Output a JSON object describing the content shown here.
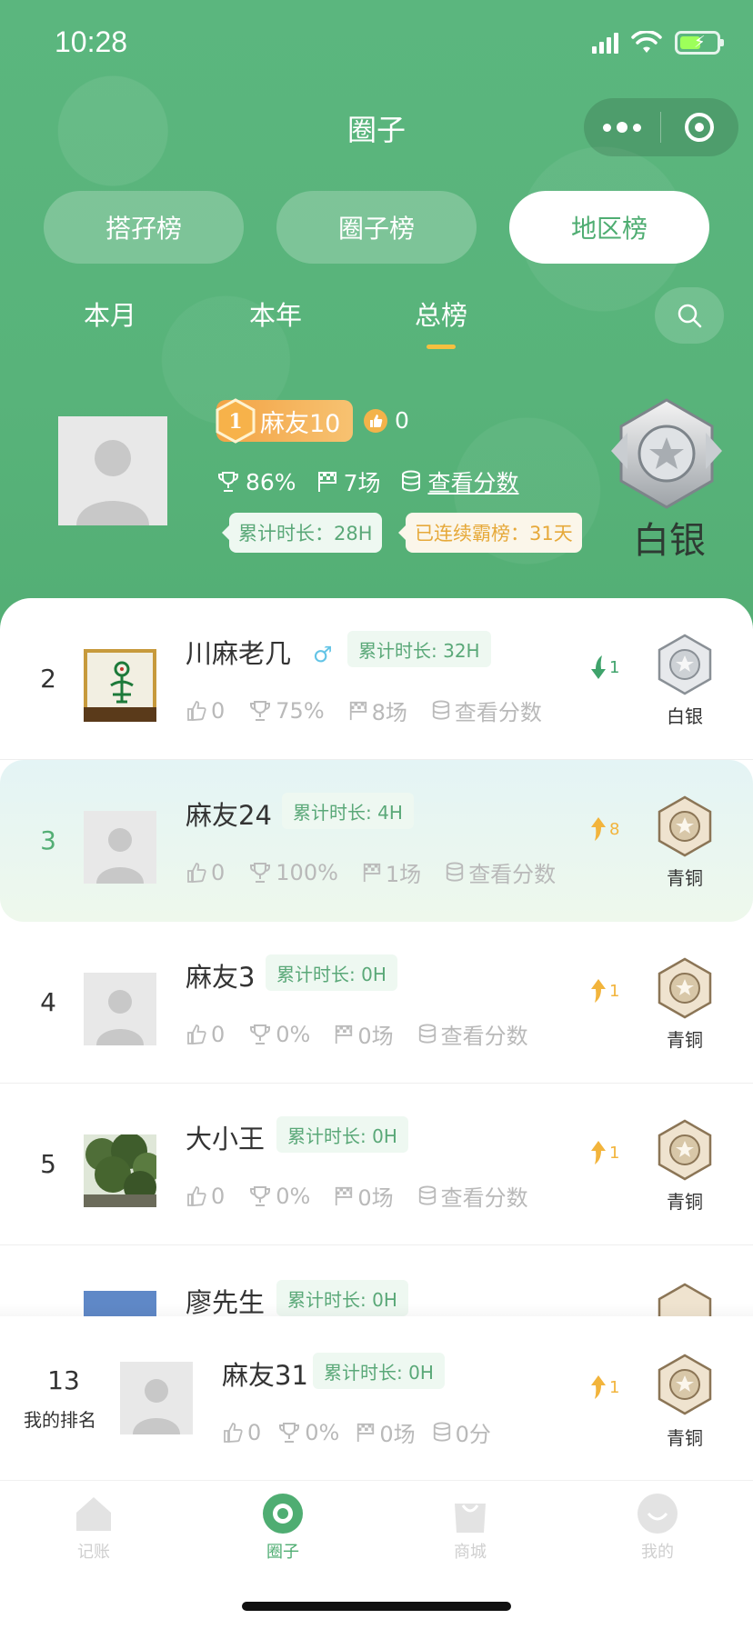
{
  "status": {
    "time": "10:28"
  },
  "nav": {
    "title": "圈子"
  },
  "tabs": [
    {
      "label": "搭孖榜",
      "active": false
    },
    {
      "label": "圈子榜",
      "active": false
    },
    {
      "label": "地区榜",
      "active": true
    }
  ],
  "periods": [
    {
      "label": "本月",
      "active": false
    },
    {
      "label": "本年",
      "active": false
    },
    {
      "label": "总榜",
      "active": true
    }
  ],
  "top_user": {
    "name": "麻友10",
    "likes": "0",
    "win_rate": "86%",
    "games": "7场",
    "score_link": "查看分数",
    "duration_tag": "累计时长：28H",
    "streak_tag": "已连续霸榜：31天",
    "rank_label": "白银"
  },
  "list": [
    {
      "rank": "2",
      "name": "川麻老几",
      "gender": "♂",
      "duration": "累计时长: 32H",
      "likes": "0",
      "win_rate": "75%",
      "games": "8场",
      "score": "查看分数",
      "trend": "1",
      "trend_dir": "down",
      "rank_label": "白银"
    },
    {
      "rank": "3",
      "name": "麻友24",
      "duration": "累计时长: 4H",
      "likes": "0",
      "win_rate": "100%",
      "games": "1场",
      "score": "查看分数",
      "trend": "8",
      "trend_dir": "up",
      "rank_label": "青铜"
    },
    {
      "rank": "4",
      "name": "麻友3",
      "duration": "累计时长: 0H",
      "likes": "0",
      "win_rate": "0%",
      "games": "0场",
      "score": "查看分数",
      "trend": "1",
      "trend_dir": "up",
      "rank_label": "青铜"
    },
    {
      "rank": "5",
      "name": "大小王",
      "duration": "累计时长: 0H",
      "likes": "0",
      "win_rate": "0%",
      "games": "0场",
      "score": "查看分数",
      "trend": "1",
      "trend_dir": "up",
      "rank_label": "青铜"
    },
    {
      "rank": "",
      "name": "廖先生",
      "duration": "累计时长: 0H"
    }
  ],
  "my_rank": {
    "rank": "13",
    "label": "我的排名",
    "name": "麻友31",
    "duration": "累计时长: 0H",
    "likes": "0",
    "win_rate": "0%",
    "games": "0场",
    "score": "0分",
    "trend": "1",
    "rank_label": "青铜"
  },
  "tabbar": [
    {
      "label": "记账",
      "icon": "home-icon",
      "active": false
    },
    {
      "label": "圈子",
      "icon": "circle-icon",
      "active": true
    },
    {
      "label": "商城",
      "icon": "shop-bag-icon",
      "active": false
    },
    {
      "label": "我的",
      "icon": "smile-icon",
      "active": false
    }
  ],
  "colors": {
    "brand_green": "#53ae74",
    "gold": "#f2b43c",
    "silver": "#9aa0a6",
    "bronze": "#b39a74"
  }
}
